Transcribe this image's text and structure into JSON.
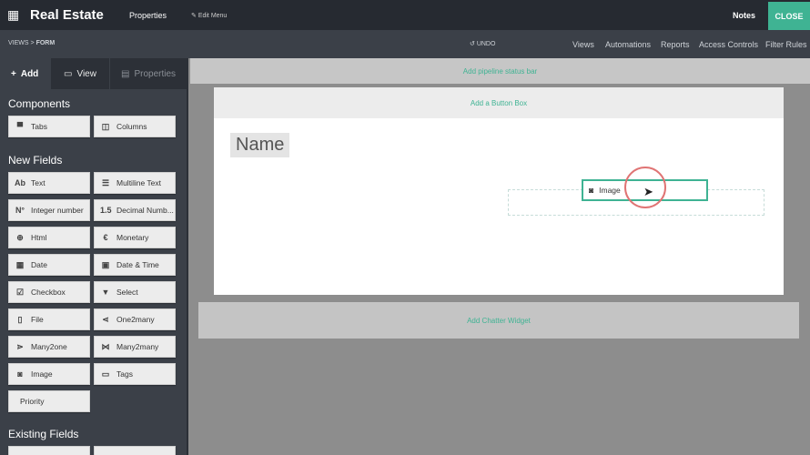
{
  "topbar": {
    "app_title": "Real Estate",
    "menu": "Properties",
    "edit_menu": "Edit Menu",
    "notes": "Notes",
    "close": "CLOSE"
  },
  "subbar": {
    "breadcrumb_views": "VIEWS",
    "breadcrumb_sep": ">",
    "breadcrumb_form": "FORM",
    "undo": "UNDO",
    "links": [
      "Views",
      "Automations",
      "Reports",
      "Access Controls",
      "Filter Rules"
    ]
  },
  "sidebar": {
    "tabs": [
      "Add",
      "View",
      "Properties"
    ],
    "components_heading": "Components",
    "components": [
      "Tabs",
      "Columns"
    ],
    "new_fields_heading": "New Fields",
    "fields": [
      {
        "icon": "Ab",
        "label": "Text"
      },
      {
        "icon": "☰",
        "label": "Multiline Text"
      },
      {
        "icon": "N°",
        "label": "Integer number"
      },
      {
        "icon": "1.5",
        "label": "Decimal Numb..."
      },
      {
        "icon": "⊕",
        "label": "Html"
      },
      {
        "icon": "€",
        "label": "Monetary"
      },
      {
        "icon": "▦",
        "label": "Date"
      },
      {
        "icon": "▣",
        "label": "Date & Time"
      },
      {
        "icon": "☑",
        "label": "Checkbox"
      },
      {
        "icon": "▼",
        "label": "Select"
      },
      {
        "icon": "▯",
        "label": "File"
      },
      {
        "icon": "⋖",
        "label": "One2many"
      },
      {
        "icon": "⋗",
        "label": "Many2one"
      },
      {
        "icon": "⋈",
        "label": "Many2many"
      },
      {
        "icon": "◙",
        "label": "Image"
      },
      {
        "icon": "▭",
        "label": "Tags"
      },
      {
        "icon": "",
        "label": "Priority"
      }
    ],
    "existing_heading": "Existing Fields"
  },
  "canvas": {
    "pipeline": "Add pipeline status bar",
    "button_box": "Add a Button Box",
    "name_field": "Name",
    "dragged_field": "Image",
    "chatter": "Add Chatter Widget"
  },
  "colors": {
    "accent": "#3fb393",
    "topbar": "#262a31"
  }
}
